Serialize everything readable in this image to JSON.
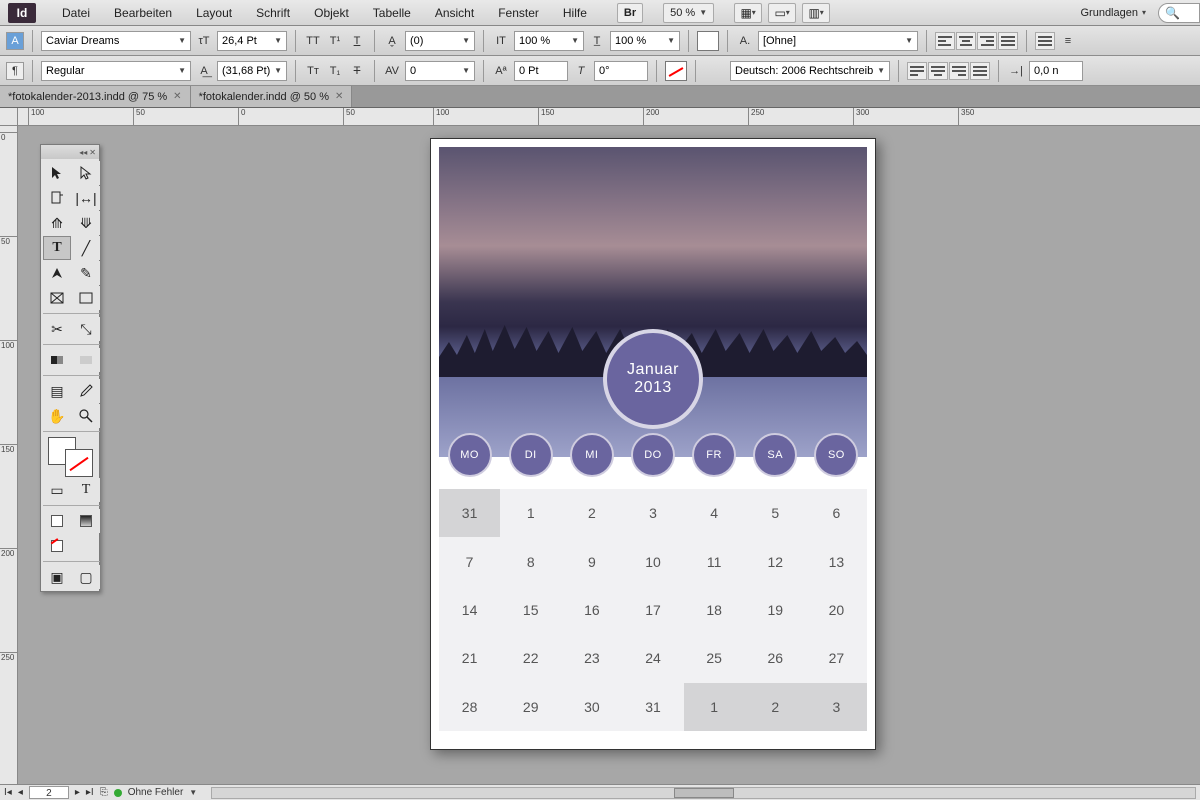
{
  "menu": {
    "items": [
      "Datei",
      "Bearbeiten",
      "Layout",
      "Schrift",
      "Objekt",
      "Tabelle",
      "Ansicht",
      "Fenster",
      "Hilfe"
    ],
    "zoom": "50 %",
    "workspace": "Grundlagen",
    "bridge": "Br"
  },
  "control": {
    "font": "Caviar Dreams",
    "style": "Regular",
    "size": "26,4 Pt",
    "leading": "(31,68 Pt)",
    "kerning": "(0)",
    "tracking": "0",
    "vscale": "100 %",
    "hscale": "100 %",
    "baseline": "0 Pt",
    "skew": "0°",
    "charstyle": "[Ohne]",
    "lang": "Deutsch: 2006 Rechtschreib",
    "opt_right": "0,0 n"
  },
  "tabs": [
    {
      "label": "*fotokalender-2013.indd @ 75 %"
    },
    {
      "label": "*fotokalender.indd @ 50 %"
    }
  ],
  "ruler_h": [
    "100",
    "50",
    "0",
    "50",
    "100",
    "150",
    "200",
    "250",
    "300",
    "350"
  ],
  "ruler_v": [
    "0",
    "50",
    "100",
    "150",
    "200",
    "250"
  ],
  "calendar": {
    "month": "Januar",
    "year": "2013",
    "day_headers": [
      "MO",
      "DI",
      "MI",
      "DO",
      "FR",
      "SA",
      "SO"
    ],
    "cells": [
      {
        "n": "31",
        "off": true
      },
      {
        "n": "1"
      },
      {
        "n": "2"
      },
      {
        "n": "3"
      },
      {
        "n": "4"
      },
      {
        "n": "5"
      },
      {
        "n": "6"
      },
      {
        "n": "7"
      },
      {
        "n": "8"
      },
      {
        "n": "9"
      },
      {
        "n": "10"
      },
      {
        "n": "11"
      },
      {
        "n": "12"
      },
      {
        "n": "13"
      },
      {
        "n": "14"
      },
      {
        "n": "15"
      },
      {
        "n": "16"
      },
      {
        "n": "17"
      },
      {
        "n": "18"
      },
      {
        "n": "19"
      },
      {
        "n": "20"
      },
      {
        "n": "21"
      },
      {
        "n": "22"
      },
      {
        "n": "23"
      },
      {
        "n": "24"
      },
      {
        "n": "25"
      },
      {
        "n": "26"
      },
      {
        "n": "27"
      },
      {
        "n": "28"
      },
      {
        "n": "29"
      },
      {
        "n": "30"
      },
      {
        "n": "31"
      },
      {
        "n": "1",
        "off": true
      },
      {
        "n": "2",
        "off": true
      },
      {
        "n": "3",
        "off": true
      }
    ]
  },
  "status": {
    "page": "2",
    "errors": "Ohne Fehler"
  }
}
